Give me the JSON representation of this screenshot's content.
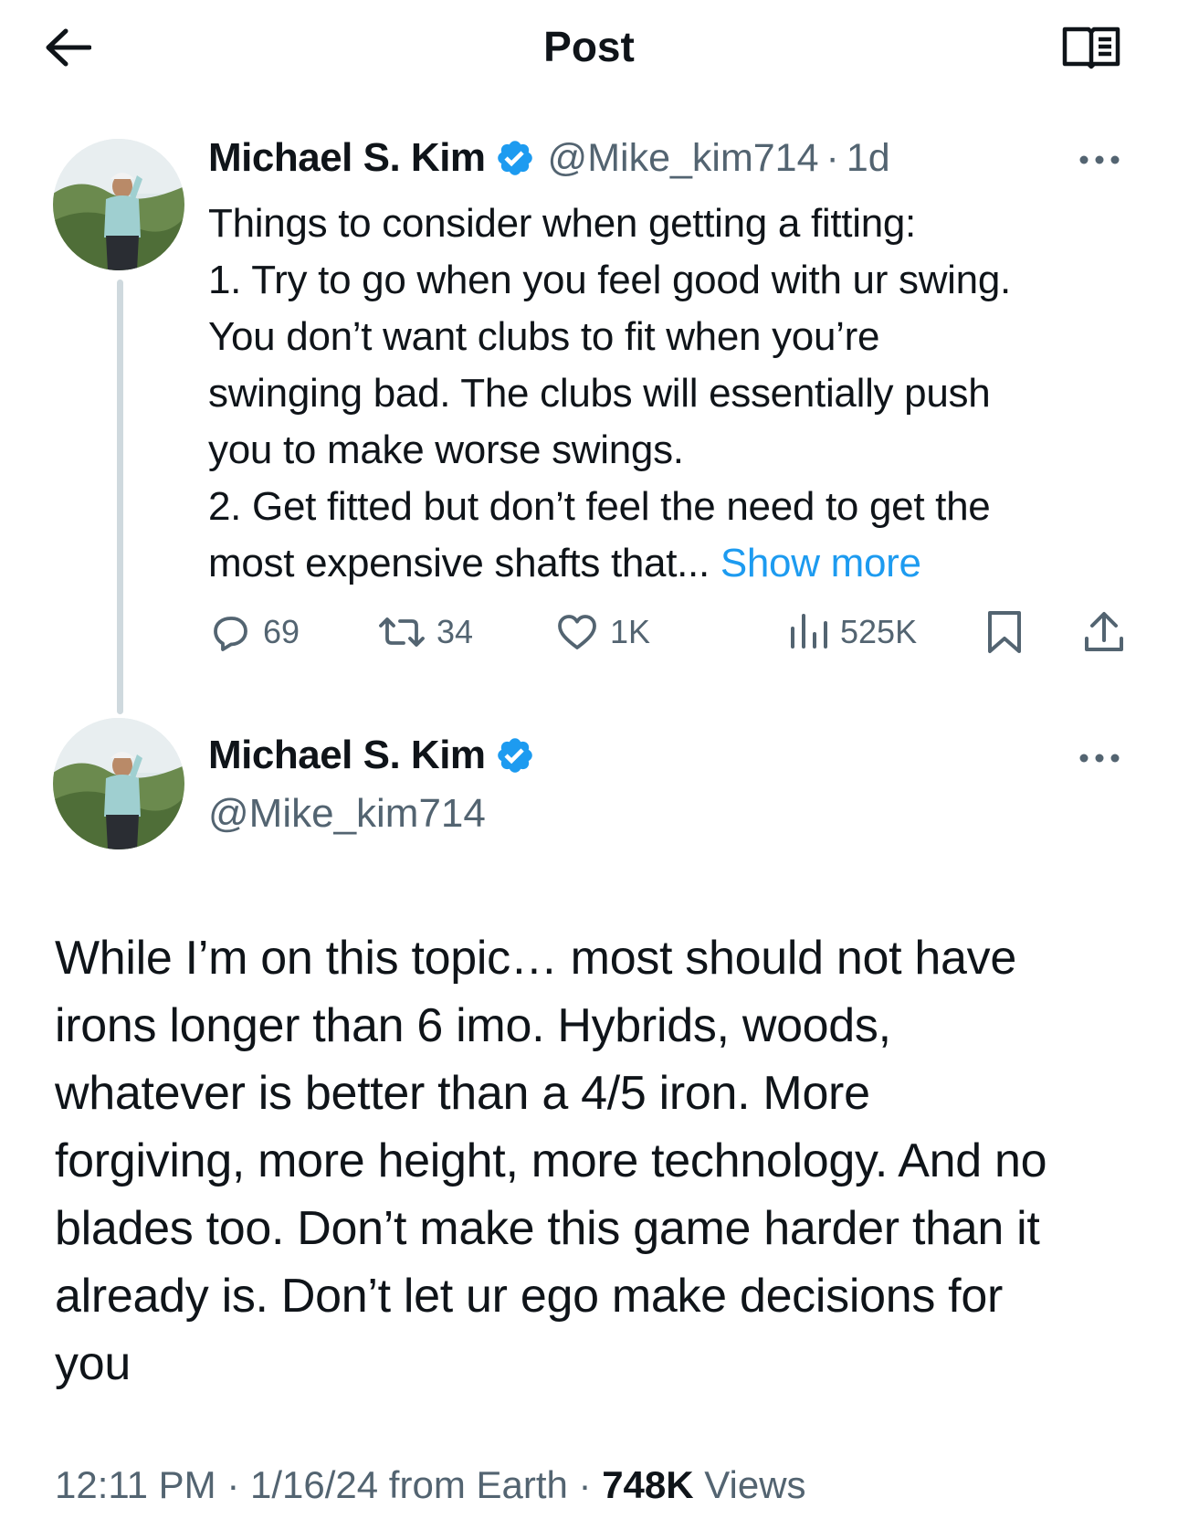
{
  "header": {
    "title": "Post",
    "back_icon": "arrow-left-icon",
    "reader_icon": "reader-mode-icon"
  },
  "parent_tweet": {
    "display_name": "Michael S. Kim",
    "handle": "@Mike_kim714",
    "separator": "·",
    "time_ago": "1d",
    "body_lines": [
      "Things to consider when getting a fitting:",
      "1. Try to go when you feel good with ur swing.",
      "You don’t want clubs to fit when you’re",
      "swinging bad. The clubs will essentially push",
      "you to make worse swings.",
      "2. Get fitted but don’t feel the need to get the",
      "most expensive shafts that..."
    ],
    "show_more": "Show more",
    "stats": {
      "replies": "69",
      "reposts": "34",
      "likes": "1K",
      "views": "525K"
    }
  },
  "main_tweet": {
    "display_name": "Michael S. Kim",
    "handle": "@Mike_kim714",
    "body_lines": [
      "While I’m on this topic… most should not have",
      "irons longer than 6 imo. Hybrids, woods,",
      "whatever is better than a 4/5 iron. More",
      "forgiving, more height, more technology. And no",
      "blades too. Don’t make this game harder than it",
      "already is. Don’t let ur ego make decisions for",
      "you"
    ],
    "time": "12:11 PM",
    "separator": "·",
    "date": "1/16/24 from Earth",
    "views_count": "748K",
    "views_label": "Views"
  },
  "colors": {
    "accent": "#1d9bf0",
    "text": "#0f1419",
    "secondary": "#536471",
    "thread_line": "#cfd9de"
  }
}
